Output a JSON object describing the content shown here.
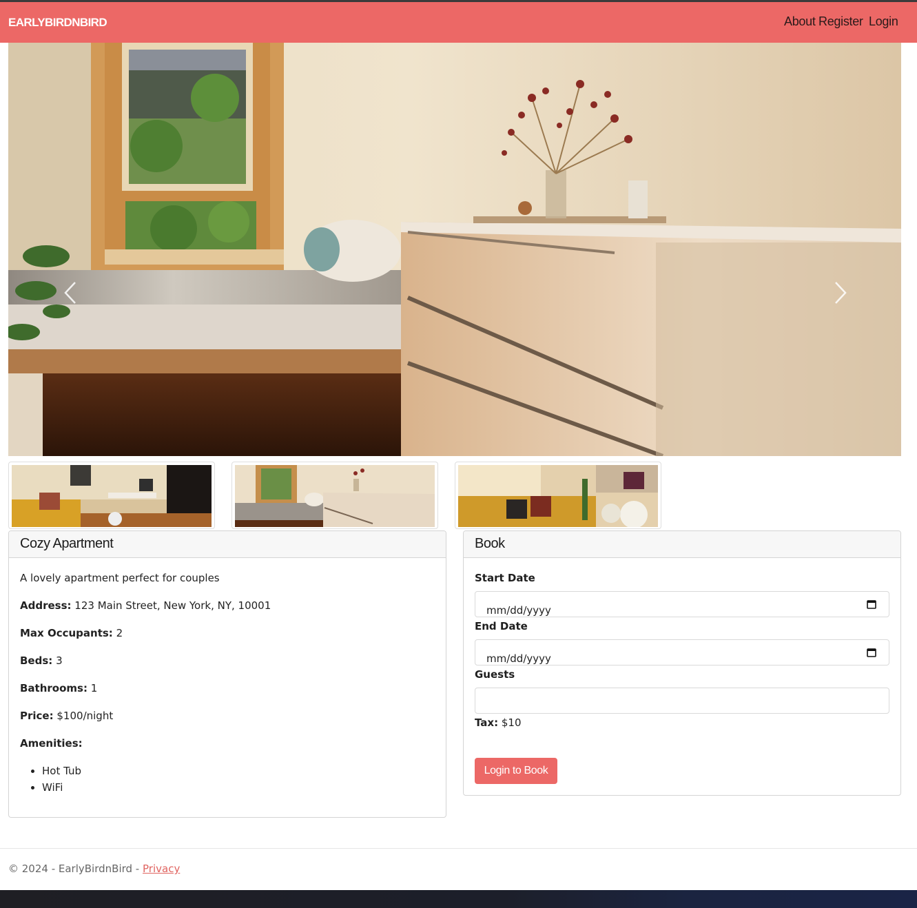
{
  "navbar": {
    "brand": "EARLYBIRDNBIRD",
    "links": [
      "About",
      "Register",
      "Login"
    ],
    "accent_color": "#ec6866"
  },
  "carousel": {
    "prev_icon": "chevron-left-icon",
    "next_icon": "chevron-right-icon",
    "thumbnails": [
      "living room with yellow sofa and desk",
      "bedroom with bed and white dresser",
      "living room sofa with plants"
    ]
  },
  "listing": {
    "title": "Cozy Apartment",
    "description": "A lovely apartment perfect for couples",
    "address_label": "Address:",
    "address": "123 Main Street, New York, NY, 10001",
    "max_occupants_label": "Max Occupants:",
    "max_occupants": "2",
    "beds_label": "Beds:",
    "beds": "3",
    "bathrooms_label": "Bathrooms:",
    "bathrooms": "1",
    "price_label": "Price:",
    "price": "$100/night",
    "amenities_label": "Amenities:",
    "amenities": [
      "Hot Tub",
      "WiFi"
    ]
  },
  "booking": {
    "title": "Book",
    "start_label": "Start Date",
    "start_value": "mm/dd/yyyy",
    "end_label": "End Date",
    "end_value": "mm/dd/yyyy",
    "guests_label": "Guests",
    "guests_value": "",
    "tax_label": "Tax:",
    "tax_value": "$10",
    "button": "Login to Book",
    "calendar_icon": "calendar-icon"
  },
  "footer": {
    "text": "© 2024 - EarlyBirdnBird -",
    "link": "Privacy"
  }
}
